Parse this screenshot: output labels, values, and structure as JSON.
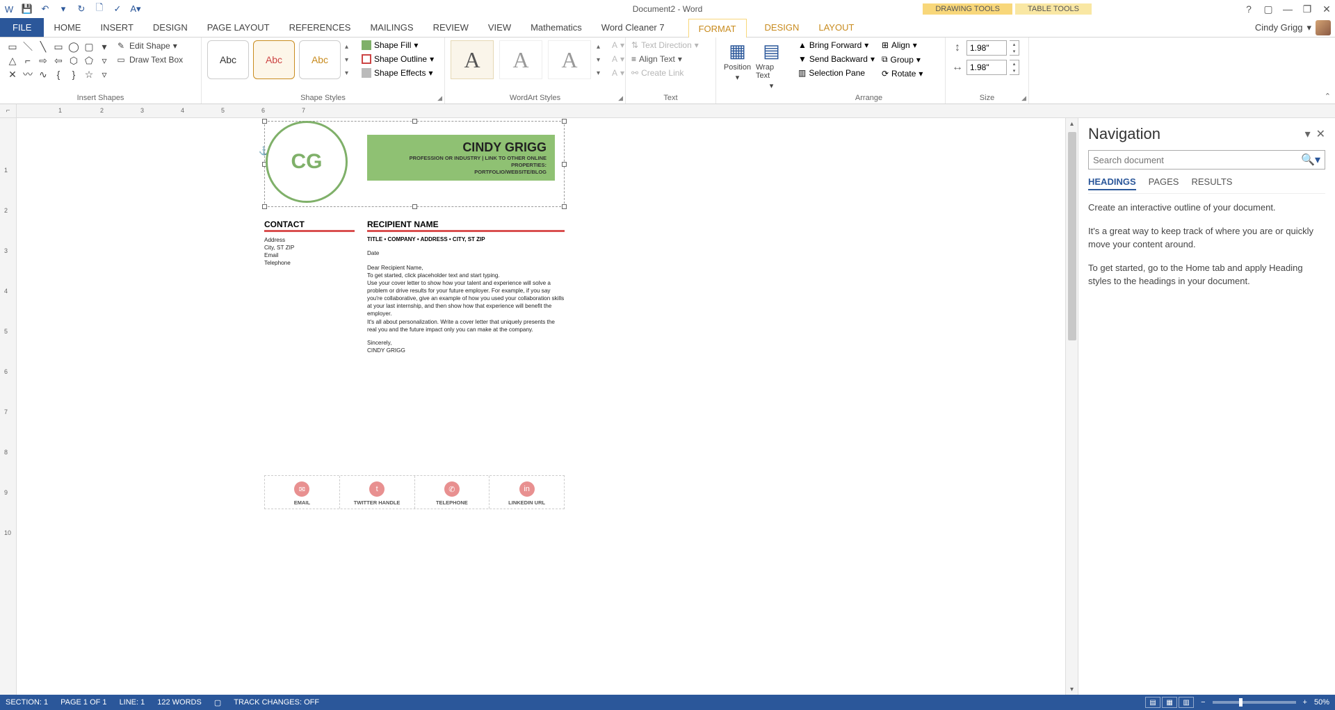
{
  "title": "Document2 - Word",
  "contextual": {
    "drawing": "DRAWING TOOLS",
    "table": "TABLE TOOLS"
  },
  "tabs": {
    "file": "FILE",
    "home": "HOME",
    "insert": "INSERT",
    "design": "DESIGN",
    "pagelayout": "PAGE LAYOUT",
    "references": "REFERENCES",
    "mailings": "MAILINGS",
    "review": "REVIEW",
    "view": "VIEW",
    "math": "Mathematics",
    "cleaner": "Word Cleaner 7",
    "format": "FORMAT",
    "design2": "DESIGN",
    "layout2": "LAYOUT"
  },
  "user": "Cindy Grigg",
  "ribbon": {
    "insertShapes": {
      "label": "Insert Shapes",
      "editShape": "Edit Shape",
      "drawTextBox": "Draw Text Box"
    },
    "shapeStyles": {
      "label": "Shape Styles",
      "sample": "Abc",
      "fill": "Shape Fill",
      "outline": "Shape Outline",
      "effects": "Shape Effects"
    },
    "wordart": {
      "label": "WordArt Styles",
      "sample": "A"
    },
    "text": {
      "label": "Text",
      "direction": "Text Direction",
      "align": "Align Text",
      "link": "Create Link"
    },
    "posWrap": {
      "position": "Position",
      "wrap": "Wrap Text"
    },
    "arrange": {
      "label": "Arrange",
      "forward": "Bring Forward",
      "backward": "Send Backward",
      "selpane": "Selection Pane",
      "align": "Align",
      "group": "Group",
      "rotate": "Rotate"
    },
    "size": {
      "label": "Size",
      "h": "1.98\"",
      "w": "1.98\""
    }
  },
  "nav": {
    "title": "Navigation",
    "searchPlaceholder": "Search document",
    "tabs": {
      "headings": "HEADINGS",
      "pages": "PAGES",
      "results": "RESULTS"
    },
    "p1": "Create an interactive outline of your document.",
    "p2": "It's a great way to keep track of where you are or quickly move your content around.",
    "p3": "To get started, go to the Home tab and apply Heading styles to the headings in your document."
  },
  "doc": {
    "initials": "CG",
    "name": "CINDY GRIGG",
    "sub1": "PROFESSION OR INDUSTRY | LINK TO OTHER ONLINE PROPERTIES:",
    "sub2": "PORTFOLIO/WEBSITE/BLOG",
    "contact": {
      "h": "CONTACT",
      "l1": "Address",
      "l2": "City, ST ZIP",
      "l3": "Email",
      "l4": "Telephone"
    },
    "recipient": {
      "h": "RECIPIENT NAME",
      "sub": "TITLE • COMPANY • ADDRESS • CITY, ST ZIP",
      "date": "Date",
      "b1": "Dear Recipient Name,",
      "b2": "To get started, click placeholder text and start typing.",
      "b3": "Use your cover letter to show how your talent and experience will solve a problem or drive results for your future employer. For example, if you say you're collaborative, give an example of how you used your collaboration skills at your last internship, and then show how that experience will benefit the employer.",
      "b4": "It's all about personalization. Write a cover letter that uniquely presents the real you and the future impact only you can make at the company.",
      "b5": "Sincerely,",
      "b6": "CINDY GRIGG"
    },
    "footer": {
      "email": "EMAIL",
      "twitter": "TWITTER HANDLE",
      "tel": "TELEPHONE",
      "linkedin": "LINKEDIN URL"
    }
  },
  "status": {
    "section": "SECTION: 1",
    "page": "PAGE 1 OF 1",
    "line": "LINE: 1",
    "words": "122 WORDS",
    "track": "TRACK CHANGES: OFF",
    "zoom": "50%"
  }
}
